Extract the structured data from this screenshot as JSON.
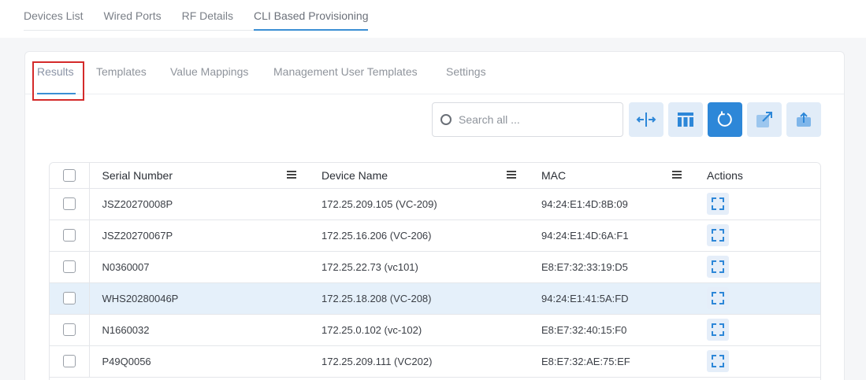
{
  "top_tabs": [
    {
      "label": "Devices List"
    },
    {
      "label": "Wired Ports"
    },
    {
      "label": "RF Details"
    },
    {
      "label": "CLI Based Provisioning"
    }
  ],
  "sub_tabs": [
    {
      "label": "Results"
    },
    {
      "label": "Templates"
    },
    {
      "label": "Value Mappings"
    },
    {
      "label": "Management User Templates"
    },
    {
      "label": "Settings"
    }
  ],
  "search": {
    "placeholder": "Search all ..."
  },
  "toolbar": {
    "icons": [
      "expand-columns-icon",
      "columns-icon",
      "refresh-icon",
      "open-external-icon",
      "upload-icon"
    ],
    "accent_color": "#2d87d8"
  },
  "table": {
    "headers": {
      "serial": "Serial Number",
      "device": "Device Name",
      "mac": "MAC",
      "actions": "Actions"
    },
    "rows": [
      {
        "serial": "JSZ20270008P",
        "device": "172.25.209.105 (VC-209)",
        "mac": "94:24:E1:4D:8B:09",
        "selected": false
      },
      {
        "serial": "JSZ20270067P",
        "device": "172.25.16.206 (VC-206)",
        "mac": "94:24:E1:4D:6A:F1",
        "selected": false
      },
      {
        "serial": "N0360007",
        "device": "172.25.22.73 (vc101)",
        "mac": "E8:E7:32:33:19:D5",
        "selected": false
      },
      {
        "serial": "WHS20280046P",
        "device": "172.25.18.208 (VC-208)",
        "mac": "94:24:E1:41:5A:FD",
        "selected": true
      },
      {
        "serial": "N1660032",
        "device": "172.25.0.102 (vc-102)",
        "mac": "E8:E7:32:40:15:F0",
        "selected": false
      },
      {
        "serial": "P49Q0056",
        "device": "172.25.209.111 (VC202)",
        "mac": "E8:E7:32:AE:75:EF",
        "selected": false
      }
    ]
  }
}
